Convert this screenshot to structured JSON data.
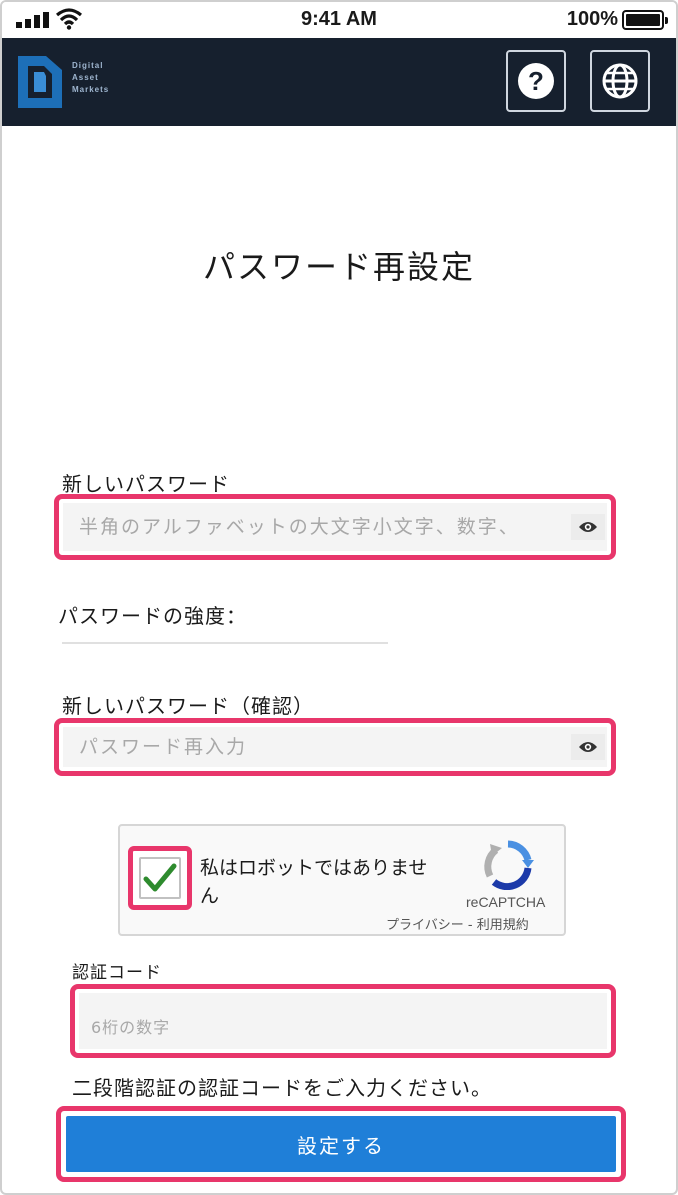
{
  "status_bar": {
    "time": "9:41 AM",
    "battery": "100%"
  },
  "header": {
    "logo_lines": [
      "Digital",
      "Asset",
      "Markets"
    ],
    "help_glyph": "?",
    "icons": {
      "help": "help-icon",
      "language": "globe-icon",
      "brand": "dam-logo"
    }
  },
  "page": {
    "title": "パスワード再設定"
  },
  "new_password": {
    "label": "新しいパスワード",
    "placeholder": "半角のアルファベットの大文字小文字、数字、",
    "value": ""
  },
  "strength": {
    "label": "パスワードの強度："
  },
  "confirm_password": {
    "label": "新しいパスワード（確認）",
    "placeholder": "パスワード再入力",
    "value": ""
  },
  "captcha": {
    "text": "私はロボットではありません",
    "checked": true,
    "brand": "reCAPTCHA",
    "links": "プライバシー - 利用規約"
  },
  "auth_code": {
    "label": "認証コード",
    "placeholder": "6桁の数字",
    "value": ""
  },
  "hint": "二段階認証の認証コードをご入力ください。",
  "submit_label": "設定する",
  "colors": {
    "header_bg": "#16202e",
    "highlight": "#e8366b",
    "primary": "#1f7fd8",
    "check": "#2e8b2e"
  }
}
